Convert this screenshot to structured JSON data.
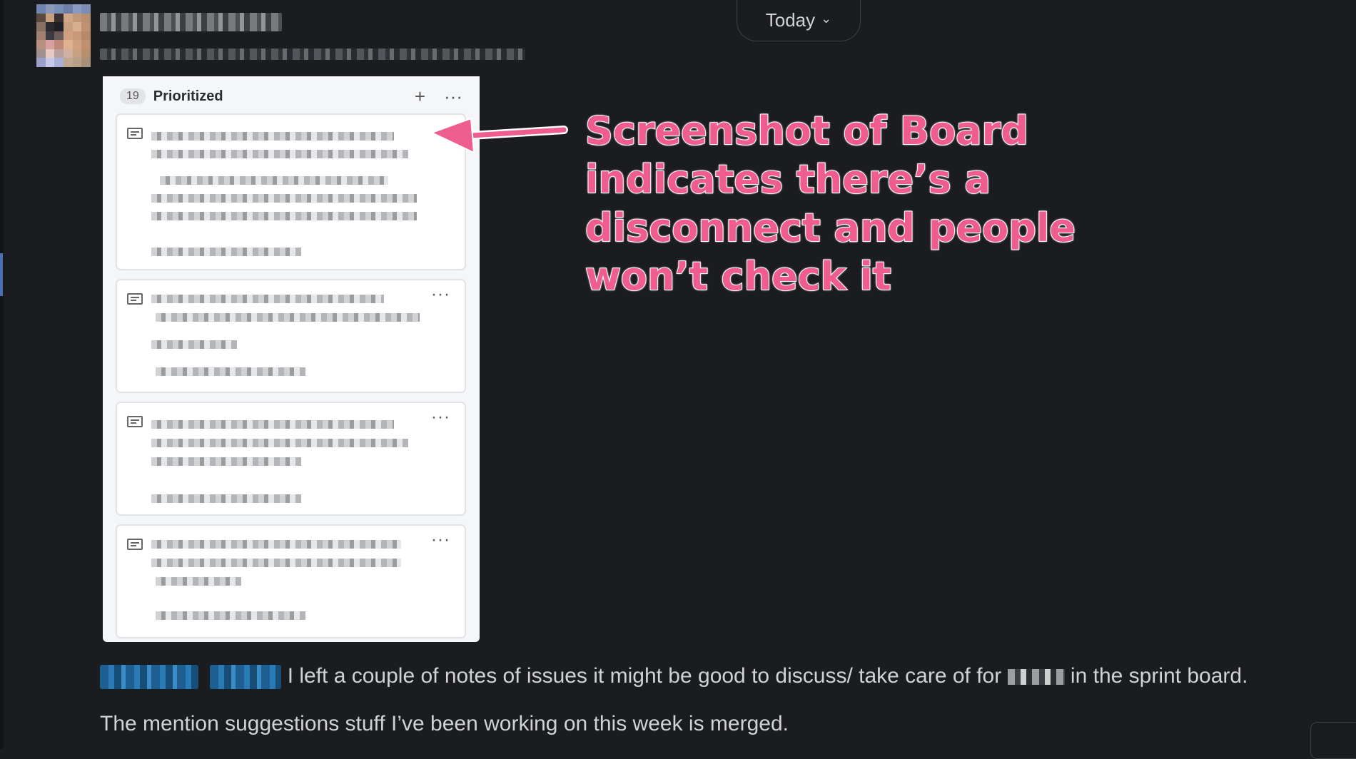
{
  "header": {
    "today_label": "Today",
    "chevron": "chevron-down-icon"
  },
  "board": {
    "count": "19",
    "column_title": "Prioritized",
    "add_glyph": "+",
    "more_glyph": "···",
    "cards": [
      {
        "has_more": false
      },
      {
        "has_more": true
      },
      {
        "has_more": true
      },
      {
        "has_more": true
      }
    ]
  },
  "annotation": {
    "lines": [
      "Screenshot of Board",
      "indicates there’s a",
      "disconnect and people",
      "won’t check it"
    ],
    "color": "#ef5d8e"
  },
  "messages": {
    "line1_text": "I left a couple of notes of issues it might be good to discuss/ take care of for",
    "line1_suffix": "in the sprint board.",
    "line2_text": "The mention suggestions stuff I’ve been working on this week is merged."
  }
}
